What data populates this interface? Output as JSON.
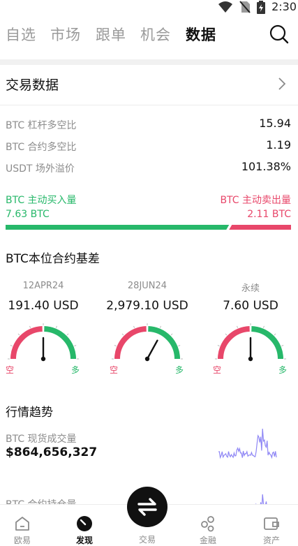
{
  "status_bar": {
    "time": "2:30"
  },
  "top_nav": {
    "tabs": [
      {
        "label": "自选",
        "active": false
      },
      {
        "label": "市场",
        "active": false
      },
      {
        "label": "跟单",
        "active": false
      },
      {
        "label": "机会",
        "active": false
      },
      {
        "label": "数据",
        "active": true
      }
    ]
  },
  "trading_data": {
    "title": "交易数据",
    "stats": [
      {
        "label": "BTC 杠杆多空比",
        "value": "15.94"
      },
      {
        "label": "BTC 合约多空比",
        "value": "1.19"
      },
      {
        "label": "USDT 场外溢价",
        "value": "101.38%"
      }
    ],
    "flow": {
      "buy_label": "BTC 主动买入量",
      "buy_value": "7.63 BTC",
      "sell_label": "BTC 主动卖出量",
      "sell_value": "2.11 BTC",
      "buy_fraction": 0.783,
      "buy_color": "#27b86a",
      "sell_color": "#e8476a"
    }
  },
  "basis": {
    "title": "BTC本位合约基差",
    "contracts": [
      {
        "label": "12APR24",
        "value": "191.40 USD",
        "short": "空",
        "long": "多",
        "needle_fraction": 0.5
      },
      {
        "label": "28JUN24",
        "value": "2,979.10 USD",
        "short": "空",
        "long": "多",
        "needle_fraction": 0.66
      },
      {
        "label": "永续",
        "value": "7.60 USD",
        "short": "空",
        "long": "多",
        "needle_fraction": 0.5
      }
    ]
  },
  "trend": {
    "title": "行情趋势",
    "rows": [
      {
        "label": "BTC 现货成交量",
        "value": "$864,656,327"
      },
      {
        "label": "BTC 合约持仓量",
        "value": ""
      }
    ],
    "spark_color": "#8e86f5"
  },
  "bottom_nav": {
    "items": [
      {
        "label": "欧易",
        "icon": "home-icon",
        "active": false
      },
      {
        "label": "发现",
        "icon": "discover-icon",
        "active": true
      },
      {
        "label": "交易",
        "icon": "swap-icon",
        "active": false
      },
      {
        "label": "金融",
        "icon": "finance-icon",
        "active": false
      },
      {
        "label": "资产",
        "icon": "wallet-icon",
        "active": false
      }
    ]
  }
}
